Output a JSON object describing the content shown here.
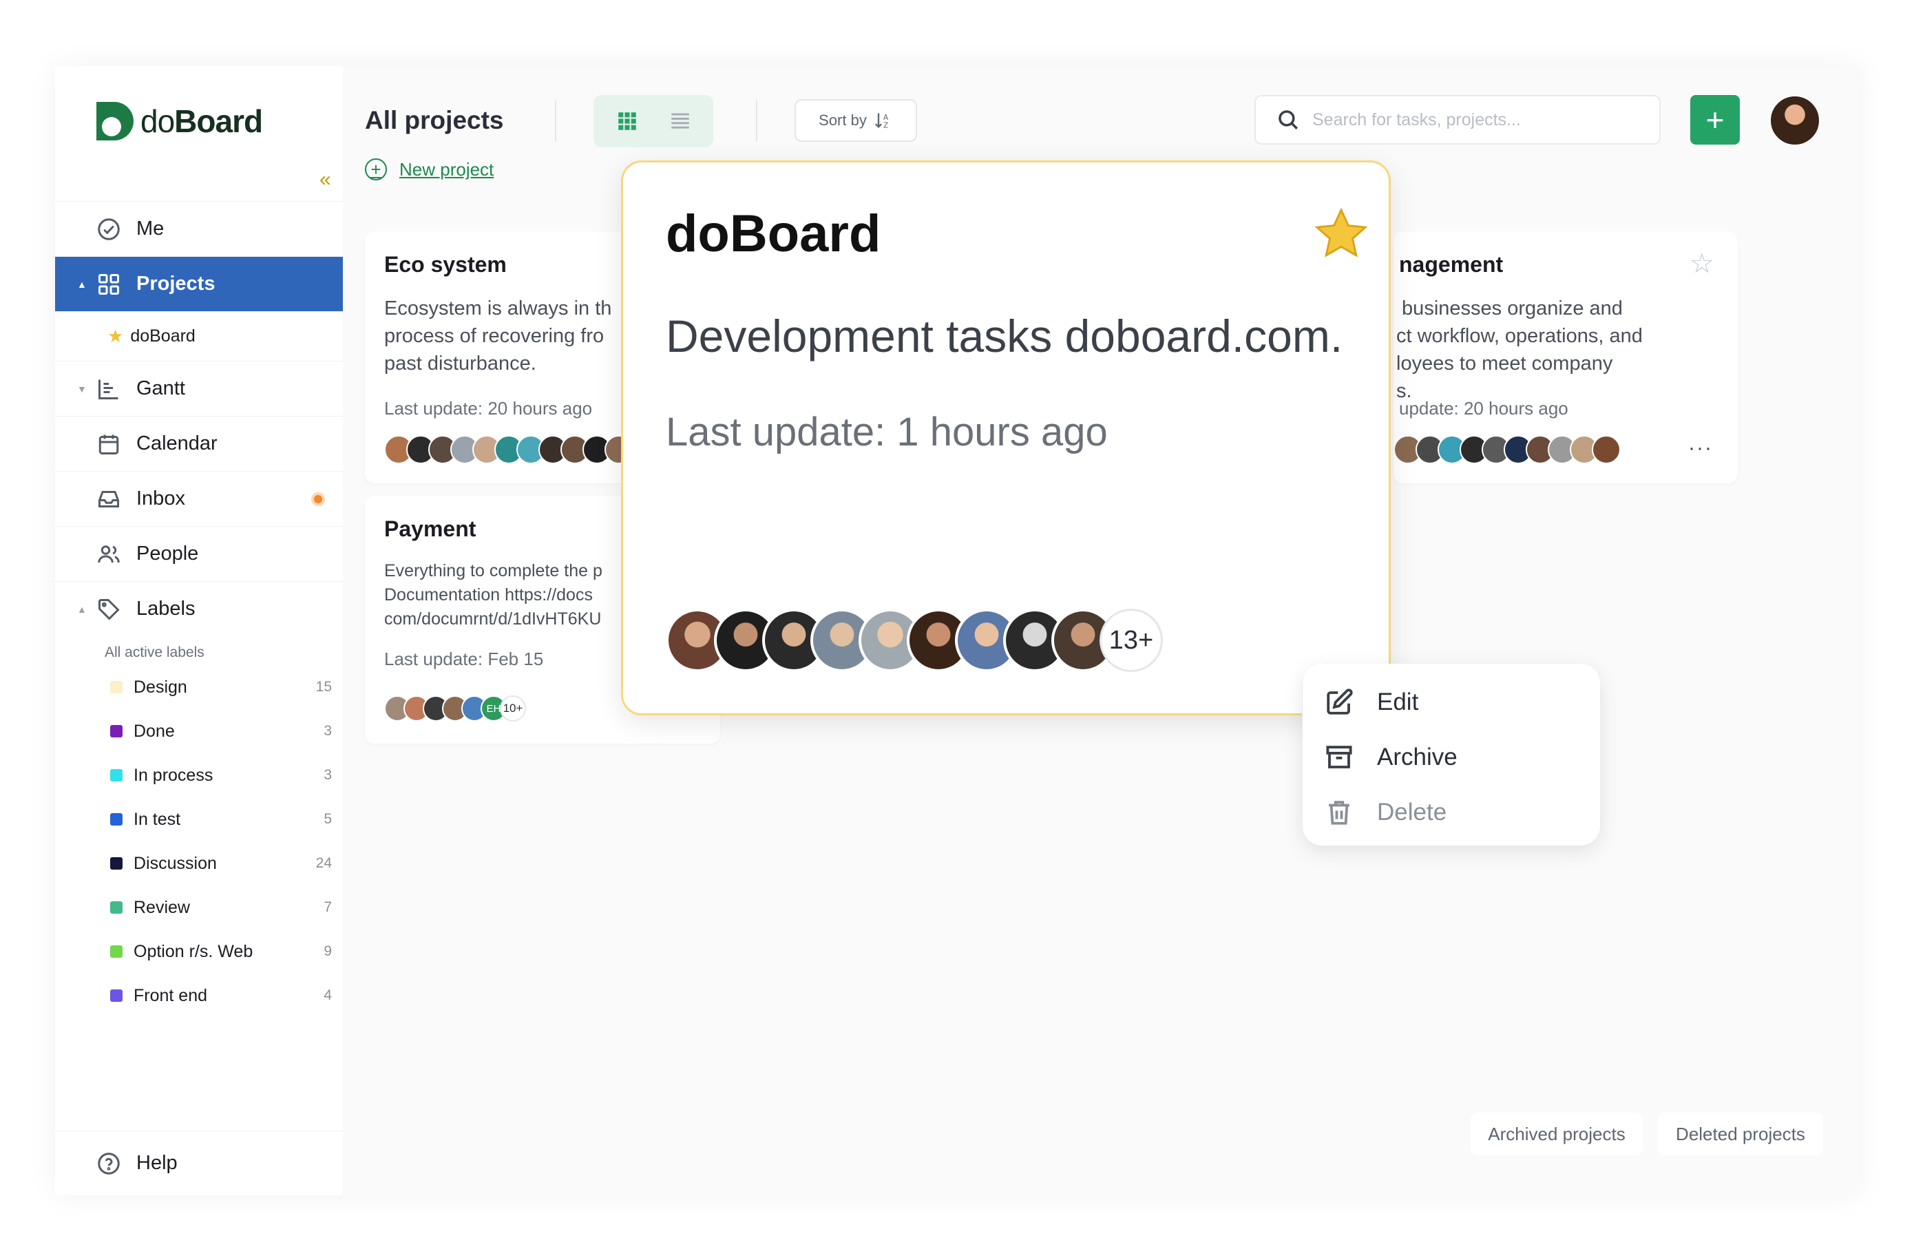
{
  "app": {
    "brand_light": "do",
    "brand_bold": "Board"
  },
  "sidebar": {
    "collapse_icon": "«",
    "items": [
      {
        "label": "Me",
        "icon": "check-circle-icon"
      },
      {
        "label": "Projects",
        "icon": "grid-icon",
        "active": true
      },
      {
        "label": "doBoard",
        "icon": "star-icon",
        "sub": true
      },
      {
        "label": "Gantt",
        "icon": "gantt-icon"
      },
      {
        "label": "Calendar",
        "icon": "calendar-icon"
      },
      {
        "label": "Inbox",
        "icon": "inbox-icon"
      },
      {
        "label": "People",
        "icon": "people-icon"
      },
      {
        "label": "Labels",
        "icon": "tag-icon"
      }
    ],
    "labels_title": "All active labels",
    "labels": [
      {
        "name": "Design",
        "count": "15",
        "color": "#fdf0c8"
      },
      {
        "name": "Done",
        "count": "3",
        "color": "#7a1fb6"
      },
      {
        "name": "In process",
        "count": "3",
        "color": "#33e0ea"
      },
      {
        "name": "In test",
        "count": "5",
        "color": "#2563d8"
      },
      {
        "name": "Discussion",
        "count": "24",
        "color": "#14163a"
      },
      {
        "name": "Review",
        "count": "7",
        "color": "#43b98c"
      },
      {
        "name": "Option r/s. Web",
        "count": "9",
        "color": "#74d64a"
      },
      {
        "name": "Front end",
        "count": "4",
        "color": "#6b54e8"
      }
    ],
    "help": "Help"
  },
  "header": {
    "title": "All projects",
    "sort_label": "Sort by",
    "search_placeholder": "Search for tasks, projects...",
    "add_label": "+",
    "new_project": "New project"
  },
  "cards": [
    {
      "title": "Eco system",
      "desc": "Ecosystem is always in th\nprocess of recovering fro\npast disturbance.",
      "update": "Last update: 20 hours ago"
    },
    {
      "title": "Payment",
      "desc": "Everything to complete the p\nDocumentation https://docs\ncom/documrnt/d/1dIvHT6KU",
      "update": "Last update: Feb 15",
      "more_count": "10+",
      "initials": "EH"
    },
    {
      "title": "nagement",
      "desc": " businesses organize and\nct workflow, operations, and\nloyees to meet company\ns.",
      "update": "update: 20 hours ago"
    }
  ],
  "popup": {
    "title": "doBoard",
    "description": "Development tasks doboard.com.",
    "update": "Last update: 1 hours ago",
    "more_count": "13+"
  },
  "menu": {
    "items": [
      {
        "label": "Edit",
        "icon": "edit-icon"
      },
      {
        "label": "Archive",
        "icon": "archive-icon"
      },
      {
        "label": "Delete",
        "icon": "trash-icon"
      }
    ]
  },
  "footer": {
    "archived": "Archived projects",
    "deleted": "Deleted projects"
  },
  "colors": {
    "accent": "#25a366",
    "active_nav": "#2f66b9",
    "star": "#f1c232"
  }
}
